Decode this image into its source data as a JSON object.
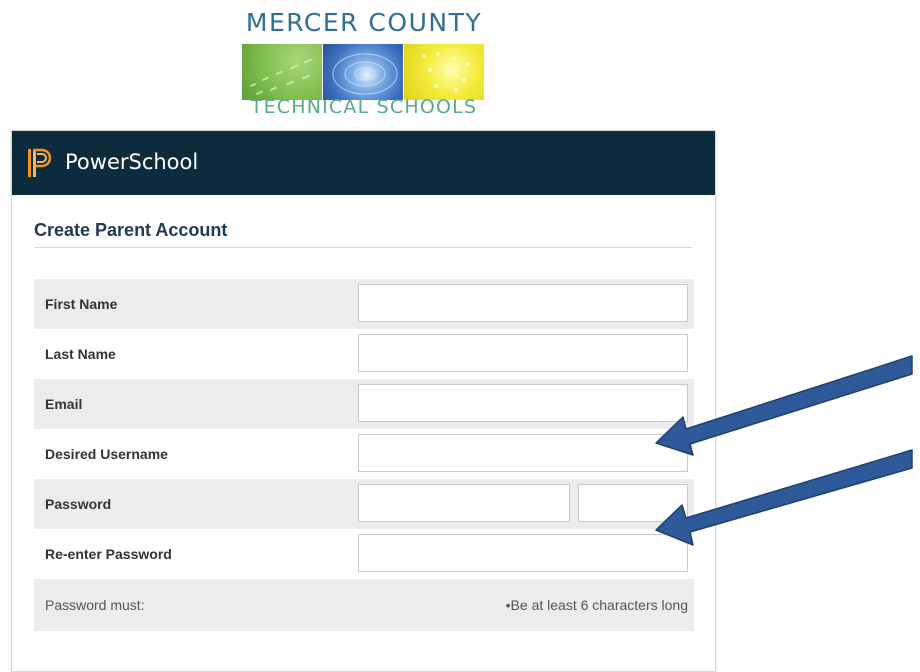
{
  "logo": {
    "top_text": "MERCER COUNTY",
    "bottom_text": "TECHNICAL SCHOOLS"
  },
  "header": {
    "brand": "PowerSchool",
    "icon": "powerschool-p-icon",
    "background": "#0c2c3e"
  },
  "form": {
    "title": "Create Parent Account",
    "fields": {
      "first_name": {
        "label": "First Name",
        "value": ""
      },
      "last_name": {
        "label": "Last Name",
        "value": ""
      },
      "email": {
        "label": "Email",
        "value": ""
      },
      "username": {
        "label": "Desired Username",
        "value": ""
      },
      "password": {
        "label": "Password",
        "value": ""
      },
      "reenter_password": {
        "label": "Re-enter Password",
        "value": ""
      }
    },
    "password_rules": {
      "label": "Password must:",
      "rule": "•Be at least 6 characters long"
    }
  },
  "annotations": {
    "arrow_color": "#2e5a9a",
    "arrow_count": 2
  }
}
